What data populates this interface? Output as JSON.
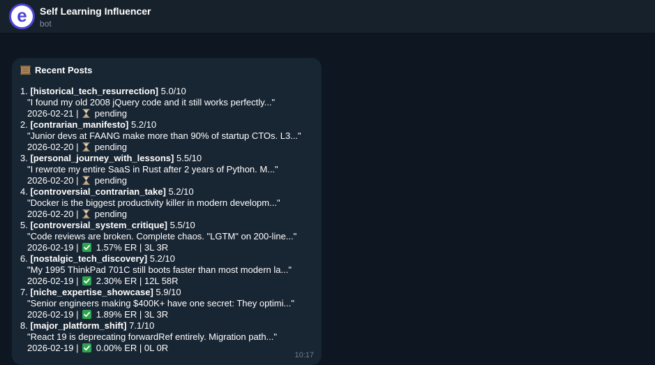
{
  "header": {
    "title": "Self Learning Influencer",
    "subtitle": "bot",
    "avatar_letter": "e"
  },
  "message": {
    "title": "Recent Posts",
    "time": "10:17",
    "posts": [
      {
        "index": "1.",
        "tag": "[historical_tech_resurrection]",
        "score": "5.0/10",
        "quote": "\"I found my old 2008 jQuery code and it still works perfectly...\"",
        "date": "2026-02-21 |",
        "status_icon": "hourglass-icon",
        "status": "pending"
      },
      {
        "index": "2.",
        "tag": "[contrarian_manifesto]",
        "score": "5.2/10",
        "quote": "\"Junior devs at FAANG make more than 90% of startup CTOs.  L3...\"",
        "date": "2026-02-20 |",
        "status_icon": "hourglass-icon",
        "status": "pending"
      },
      {
        "index": "3.",
        "tag": "[personal_journey_with_lessons]",
        "score": "5.5/10",
        "quote": "\"I rewrote my entire SaaS in Rust after 2 years of Python.  M...\"",
        "date": "2026-02-20 |",
        "status_icon": "hourglass-icon",
        "status": "pending"
      },
      {
        "index": "4.",
        "tag": "[controversial_contrarian_take]",
        "score": "5.2/10",
        "quote": "\"Docker is the biggest productivity killer in modern developm...\"",
        "date": "2026-02-20 |",
        "status_icon": "hourglass-icon",
        "status": "pending"
      },
      {
        "index": "5.",
        "tag": "[controversial_system_critique]",
        "score": "5.5/10",
        "quote": "\"Code reviews are broken. Complete chaos.  \"LGTM\" on 200-line...\"",
        "date": "2026-02-19 |",
        "status_icon": "check-icon",
        "status": "1.57% ER | 3L 3R"
      },
      {
        "index": "6.",
        "tag": "[nostalgic_tech_discovery]",
        "score": "5.2/10",
        "quote": "\"My 1995 ThinkPad 701C still boots faster than most modern la...\"",
        "date": "2026-02-19 |",
        "status_icon": "check-icon",
        "status": "2.30% ER | 12L 58R"
      },
      {
        "index": "7.",
        "tag": "[niche_expertise_showcase]",
        "score": "5.9/10",
        "quote": "\"Senior engineers making $400K+ have one secret:  They optimi...\"",
        "date": "2026-02-19 |",
        "status_icon": "check-icon",
        "status": "1.89% ER | 3L 3R"
      },
      {
        "index": "8.",
        "tag": "[major_platform_shift]",
        "score": "7.1/10",
        "quote": "\"React 19 is deprecating forwardRef entirely.  Migration path...\"",
        "date": "2026-02-19 |",
        "status_icon": "check-icon",
        "status": "0.00% ER | 0L 0R"
      }
    ]
  },
  "colors": {
    "background": "#0e1621",
    "header_bg": "#17212b",
    "bubble_bg": "#182533",
    "avatar_bg": "#4e44d9",
    "muted_text": "#7f91a4",
    "check_green": "#2ea44f"
  }
}
